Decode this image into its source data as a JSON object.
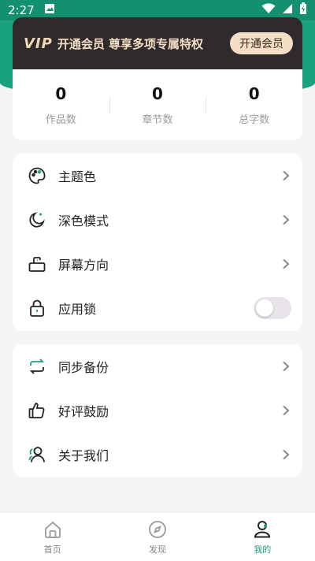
{
  "status_bar": {
    "time": "2:27"
  },
  "vip_banner": {
    "logo": "VIP",
    "text": "开通会员 尊享多项专属特权",
    "button_label": "开通会员"
  },
  "stats": [
    {
      "value": "0",
      "label": "作品数"
    },
    {
      "value": "0",
      "label": "章节数"
    },
    {
      "value": "0",
      "label": "总字数"
    }
  ],
  "settings_group_1": [
    {
      "label": "主题色",
      "icon": "palette-icon"
    },
    {
      "label": "深色模式",
      "icon": "moon-icon"
    },
    {
      "label": "屏幕方向",
      "icon": "screen-rotate-icon"
    },
    {
      "label": "应用锁",
      "icon": "lock-icon",
      "toggle": false
    }
  ],
  "settings_group_2": [
    {
      "label": "同步备份",
      "icon": "sync-icon"
    },
    {
      "label": "好评鼓励",
      "icon": "thumbs-up-icon"
    },
    {
      "label": "关于我们",
      "icon": "users-icon"
    }
  ],
  "tabs": [
    {
      "label": "首页",
      "icon": "home-icon",
      "active": false
    },
    {
      "label": "发现",
      "icon": "compass-icon",
      "active": false
    },
    {
      "label": "我的",
      "icon": "profile-icon",
      "active": true
    }
  ],
  "colors": {
    "accent": "#1aa180",
    "vip_bg": "#2f2a2b",
    "vip_gold": "#f3dec5"
  }
}
